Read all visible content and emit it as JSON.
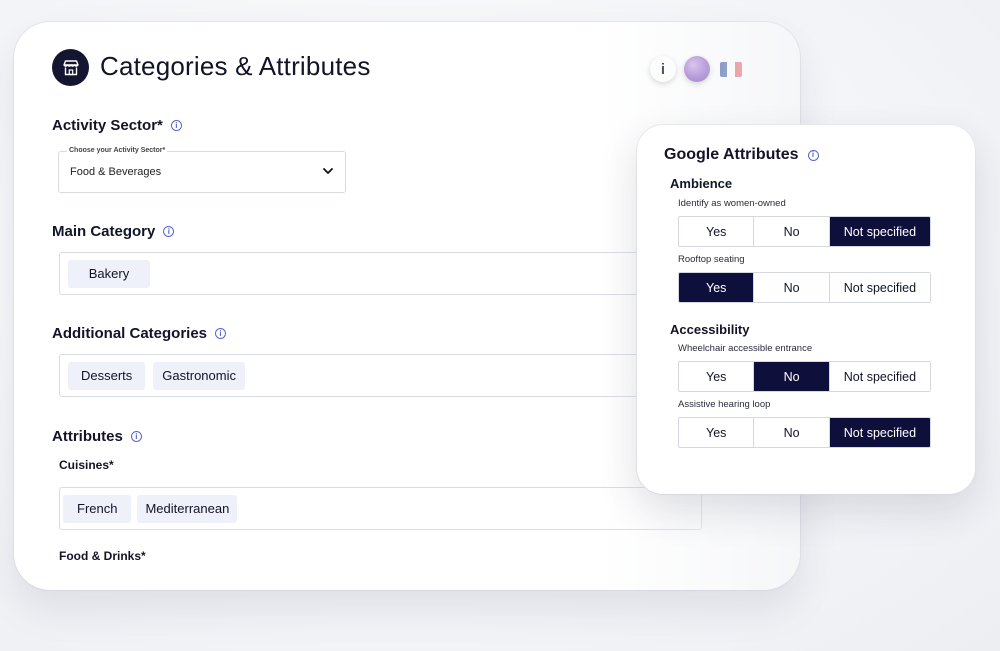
{
  "header": {
    "title": "Categories & Attributes",
    "info_label": "i",
    "flag_colors": [
      "#1d3f9a",
      "#ffffff",
      "#e1343d"
    ]
  },
  "activity_sector": {
    "title": "Activity Sector*",
    "caption": "Choose your Activity Sector*",
    "value": "Food & Beverages"
  },
  "main_category": {
    "title": "Main Category",
    "chips": [
      "Bakery"
    ]
  },
  "additional_categories": {
    "title": "Additional Categories",
    "chips": [
      "Desserts",
      "Gastronomic"
    ]
  },
  "attributes": {
    "title": "Attributes",
    "cuisines_label": "Cuisines*",
    "cuisines": [
      "French",
      "Mediterranean"
    ],
    "food_drinks_label": "Food & Drinks*"
  },
  "google_attributes": {
    "title": "Google Attributes",
    "options": [
      "Yes",
      "No",
      "Not specified"
    ],
    "groups": [
      {
        "name": "Ambience",
        "items": [
          {
            "label": "Identify as women-owned",
            "selected": "Not specified"
          },
          {
            "label": "Rooftop seating",
            "selected": "Yes"
          }
        ]
      },
      {
        "name": "Accessibility",
        "items": [
          {
            "label": "Wheelchair accessible entrance",
            "selected": "No"
          },
          {
            "label": "Assistive hearing loop",
            "selected": "Not specified"
          }
        ]
      }
    ]
  },
  "colors": {
    "accent_dark": "#0e0f3b",
    "chip_bg": "#eef0fa",
    "info_blue": "#5566cc"
  }
}
